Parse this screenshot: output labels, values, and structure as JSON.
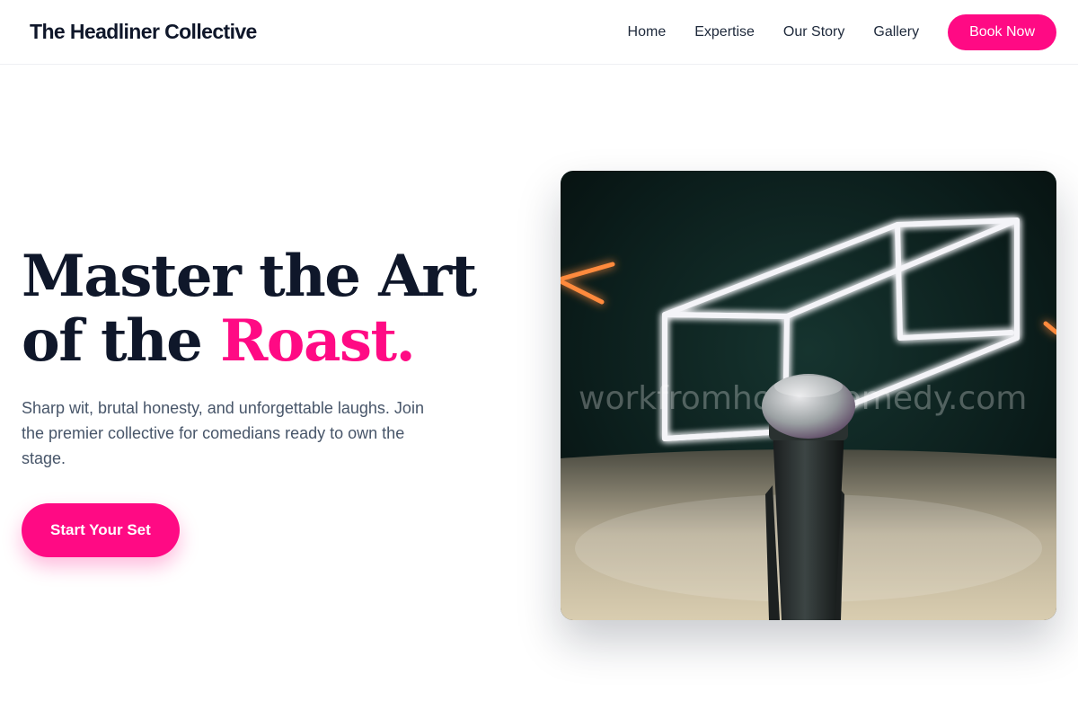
{
  "header": {
    "brand": "The Headliner Collective",
    "nav": [
      "Home",
      "Expertise",
      "Our Story",
      "Gallery"
    ],
    "book_label": "Book Now"
  },
  "hero": {
    "headline_line1": "Master the Art",
    "headline_line2_prefix": "of the ",
    "headline_accent": "Roast.",
    "subtext": "Sharp wit, brutal honesty, and unforgettable laughs. Join the premier collective for comedians ready to own the stage.",
    "cta_label": "Start Your Set",
    "image_watermark": "workfromhomecomedy.com"
  },
  "colors": {
    "accent": "#ff0a84",
    "heading": "#0f172a",
    "body": "#475569"
  }
}
